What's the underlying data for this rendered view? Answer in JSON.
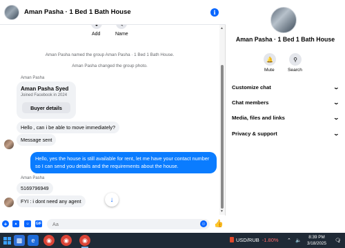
{
  "header": {
    "title": "Aman Pasha · 1 Bed 1 Bath House",
    "info_icon": "info-icon"
  },
  "quick_actions": [
    {
      "label": "Add",
      "icon": "add-person-icon"
    },
    {
      "label": "Name",
      "icon": "pencil-icon"
    }
  ],
  "system_messages": [
    "Aman Pasha named the group Aman Pasha · 1 Bed 1 Bath House.",
    "Aman Pasha changed the group photo."
  ],
  "thread": {
    "sender_name_1": "Aman Pasha",
    "card": {
      "name": "Aman Pasha Syed",
      "sub": "Joined Facebook in 2024",
      "button": "Buyer details"
    },
    "msg1": "Hello , can i be able to move immediately?",
    "msg2": "Message sent",
    "reply": "Hello, yes the house is still available for rent, let me have your contact number so I can send you details and the requirements about the house.",
    "sender_name_2": "Aman Pasha",
    "msg3": "5169796949",
    "msg4": "FYI : i dont need any agent"
  },
  "composer": {
    "placeholder": "Aa"
  },
  "panel": {
    "title": "Aman Pasha · 1 Bed 1 Bath House",
    "actions": [
      {
        "label": "Mute",
        "icon": "bell-icon"
      },
      {
        "label": "Search",
        "icon": "search-icon"
      }
    ],
    "menu": [
      "Customize chat",
      "Chat members",
      "Media, files and links",
      "Privacy & support"
    ]
  },
  "taskbar": {
    "ticker_symbol": "USD/RUB",
    "ticker_change": "-1.80%",
    "time": "8:39 PM",
    "date": "3/18/2025",
    "notifications": "2"
  },
  "colors": {
    "accent": "#0866ff",
    "outgoing_bubble": "#0a7cff",
    "incoming_bubble": "#f0f2f5",
    "taskbar": "#1f2a36"
  }
}
